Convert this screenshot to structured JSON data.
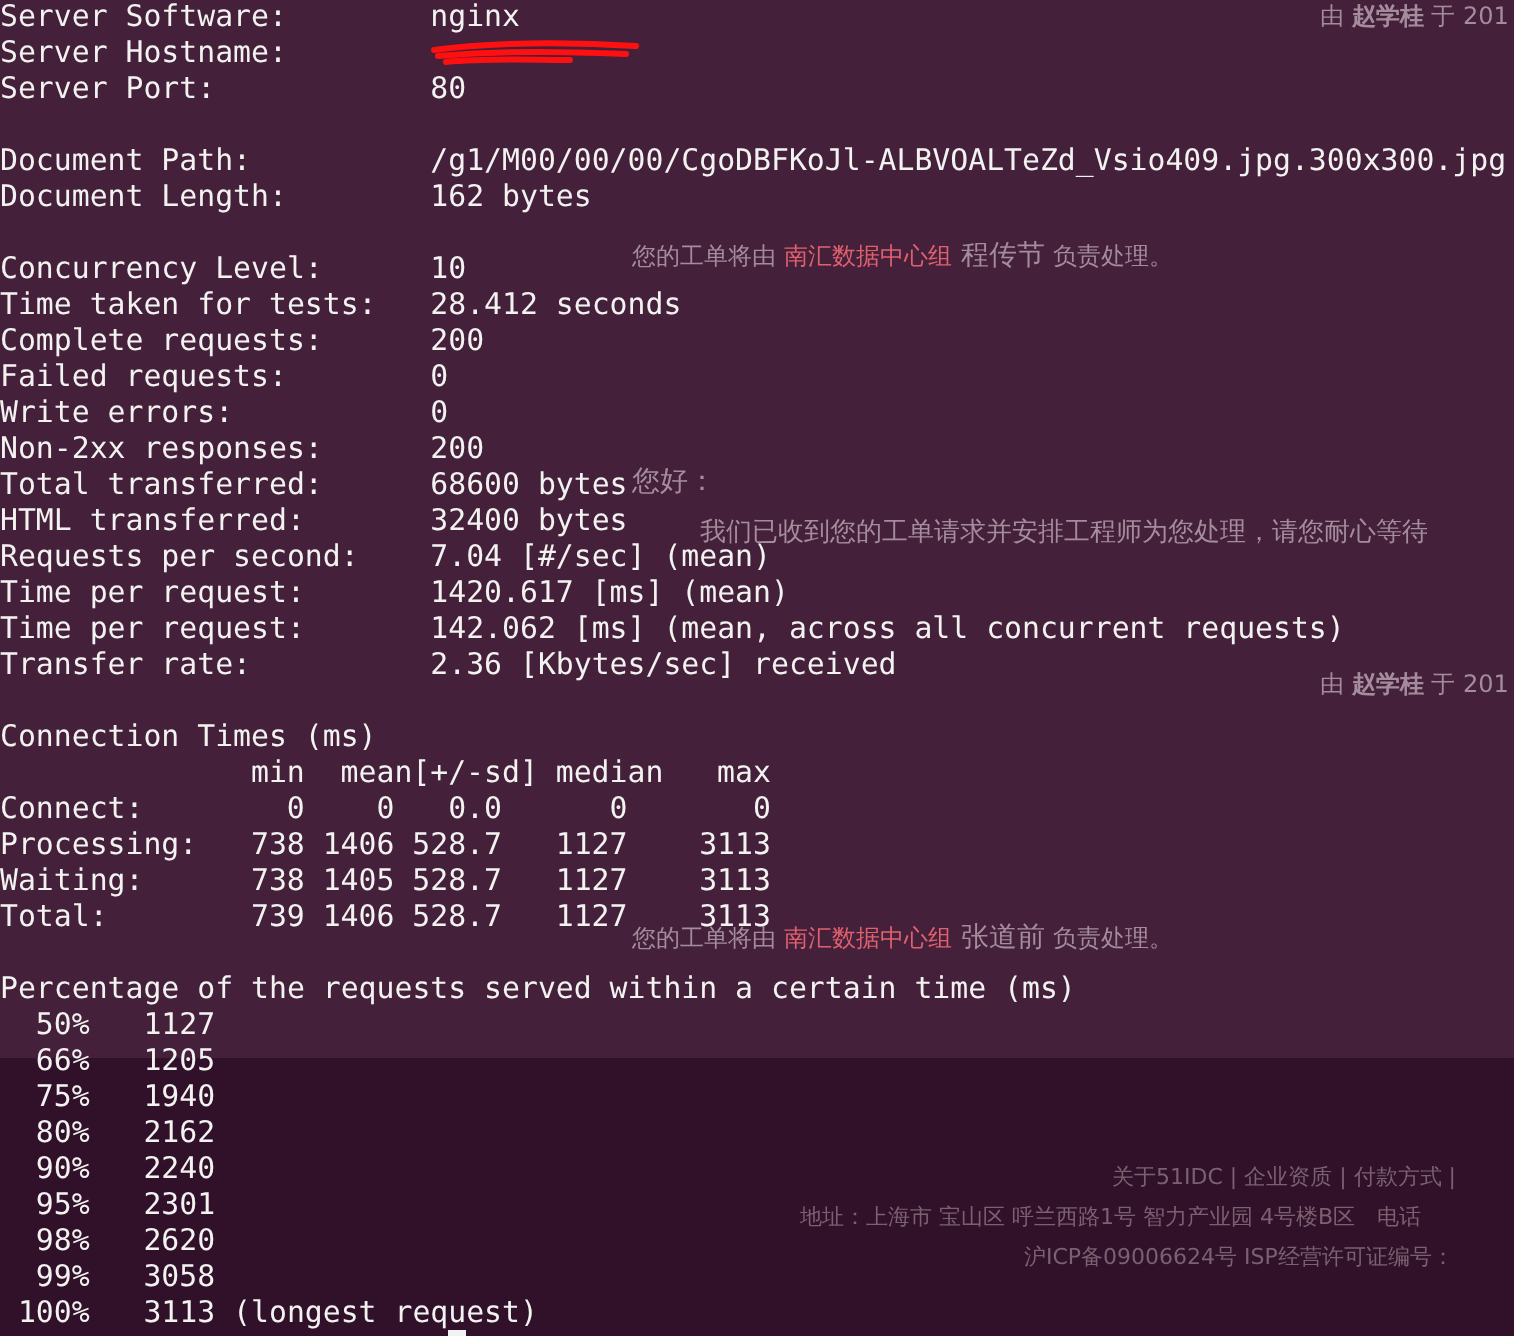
{
  "background_page": {
    "notes": [
      {
        "kind": "byline",
        "text": "由 **赵学桂** 于 201"
      },
      {
        "kind": "assign",
        "lead": "您的工单将由",
        "group": "南汇数据中心组",
        "person": "程传节",
        "tail": "负责处理。"
      },
      {
        "kind": "greeting",
        "text": "您好："
      },
      {
        "kind": "message",
        "text": "我们已收到您的工单请求并安排工程师为您处理，请您耐心等待"
      },
      {
        "kind": "byline",
        "text": "由 **赵学桂** 于 201"
      },
      {
        "kind": "assign",
        "lead": "您的工单将由",
        "group": "南汇数据中心组",
        "person": "张道前",
        "tail": "负责处理。"
      }
    ],
    "footer": [
      "关于51IDC | 企业资质 | 付款方式 |",
      "地址：上海市 宝山区 呼兰西路1号 智力产业园 4号楼B区　电话",
      "沪ICP备09006624号 ISP经营许可证编号："
    ]
  },
  "terminal": {
    "lines": [
      {
        "kind": "field",
        "label": "Server Software:",
        "value": "nginx"
      },
      {
        "kind": "redacted",
        "label": "Server Hostname:"
      },
      {
        "kind": "field",
        "label": "Server Port:",
        "value": "80"
      },
      {
        "kind": "blank"
      },
      {
        "kind": "field",
        "label": "Document Path:",
        "value": "/g1/M00/00/00/CgoDBFKoJl-ALBVOALTeZd_Vsio409.jpg.300x300.jpg"
      },
      {
        "kind": "field",
        "label": "Document Length:",
        "value": "162 bytes"
      },
      {
        "kind": "blank"
      },
      {
        "kind": "field",
        "label": "Concurrency Level:",
        "value": "10"
      },
      {
        "kind": "field",
        "label": "Time taken for tests:",
        "value": "28.412 seconds"
      },
      {
        "kind": "field",
        "label": "Complete requests:",
        "value": "200"
      },
      {
        "kind": "field",
        "label": "Failed requests:",
        "value": "0"
      },
      {
        "kind": "field",
        "label": "Write errors:",
        "value": "0"
      },
      {
        "kind": "field",
        "label": "Non-2xx responses:",
        "value": "200"
      },
      {
        "kind": "field",
        "label": "Total transferred:",
        "value": "68600 bytes"
      },
      {
        "kind": "field",
        "label": "HTML transferred:",
        "value": "32400 bytes"
      },
      {
        "kind": "field",
        "label": "Requests per second:",
        "value": "7.04 [#/sec] (mean)"
      },
      {
        "kind": "field",
        "label": "Time per request:",
        "value": "1420.617 [ms] (mean)"
      },
      {
        "kind": "field",
        "label": "Time per request:",
        "value": "142.062 [ms] (mean, across all concurrent requests)"
      },
      {
        "kind": "field",
        "label": "Transfer rate:",
        "value": "2.36 [Kbytes/sec] received"
      },
      {
        "kind": "blank"
      },
      {
        "kind": "text",
        "text": "Connection Times (ms)"
      },
      {
        "kind": "header",
        "cells": [
          "min",
          "mean[+/-sd]",
          "median",
          "max"
        ]
      },
      {
        "kind": "row",
        "label": "Connect:",
        "cells": [
          "0",
          "0",
          "0.0",
          "0",
          "0"
        ]
      },
      {
        "kind": "row",
        "label": "Processing:",
        "cells": [
          "738",
          "1406",
          "528.7",
          "1127",
          "3113"
        ]
      },
      {
        "kind": "row",
        "label": "Waiting:",
        "cells": [
          "738",
          "1405",
          "528.7",
          "1127",
          "3113"
        ]
      },
      {
        "kind": "row",
        "label": "Total:",
        "cells": [
          "739",
          "1406",
          "528.7",
          "1127",
          "3113"
        ]
      },
      {
        "kind": "blank"
      },
      {
        "kind": "text",
        "text": "Percentage of the requests served within a certain time (ms)"
      },
      {
        "kind": "percentile",
        "percent": "50%",
        "value": "1127"
      },
      {
        "kind": "percentile",
        "percent": "66%",
        "value": "1205"
      },
      {
        "kind": "percentile",
        "percent": "75%",
        "value": "1940"
      },
      {
        "kind": "percentile",
        "percent": "80%",
        "value": "2162"
      },
      {
        "kind": "percentile",
        "percent": "90%",
        "value": "2240"
      },
      {
        "kind": "percentile",
        "percent": "95%",
        "value": "2301"
      },
      {
        "kind": "percentile",
        "percent": "98%",
        "value": "2620"
      },
      {
        "kind": "percentile",
        "percent": "99%",
        "value": "3058"
      },
      {
        "kind": "percentile",
        "percent": "100%",
        "value": "3113",
        "note": "(longest request)"
      },
      {
        "kind": "cursor"
      }
    ]
  }
}
